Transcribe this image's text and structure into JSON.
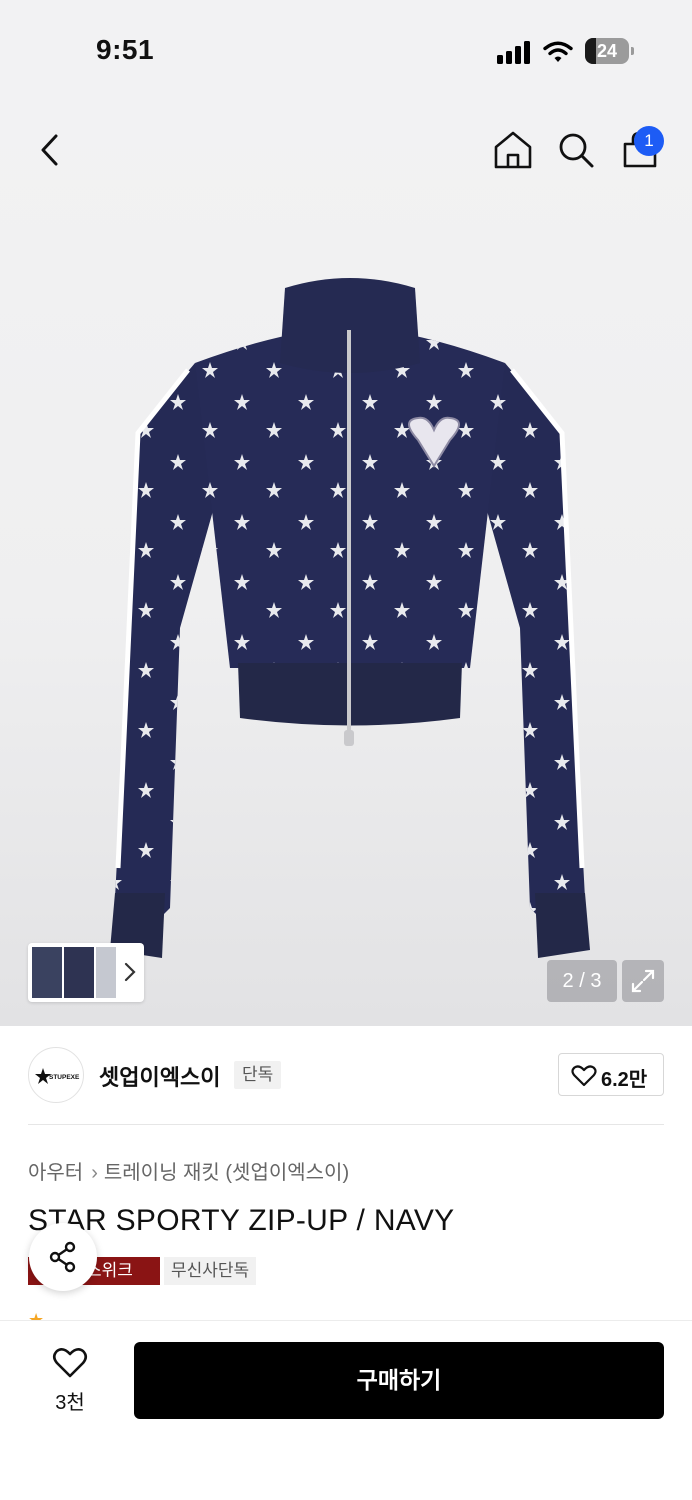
{
  "status_bar": {
    "time": "9:51",
    "battery": "24",
    "battery_level": 0.24,
    "icons": [
      "cellular-signal-icon",
      "wifi-icon",
      "battery-icon"
    ]
  },
  "nav": {
    "icons": [
      "back-chevron-icon",
      "home-icon",
      "search-icon",
      "shopping-bag-icon"
    ],
    "cart_count": "1",
    "accent_color": "#1d5cf5"
  },
  "gallery": {
    "pager": "2 / 3",
    "icons": [
      "thumbnail-next-chevron-icon",
      "expand-icon"
    ]
  },
  "brand": {
    "logo_text": "STUPEXE",
    "name": "셋업이엑스이",
    "tag": "단독",
    "likes": "6.2만"
  },
  "breadcrumb": {
    "category": "아우터",
    "subcategory": "트레이닝 재킷 (셋업이엑스이)"
  },
  "product": {
    "title": "STAR SPORTY ZIP-UP / NAVY",
    "badge_primary": "스위크",
    "badge_secondary": "무신사단독",
    "badge_primary_color": "#8a1414"
  },
  "bottom_bar": {
    "wish_count": "3천",
    "buy_label": "구매하기"
  }
}
